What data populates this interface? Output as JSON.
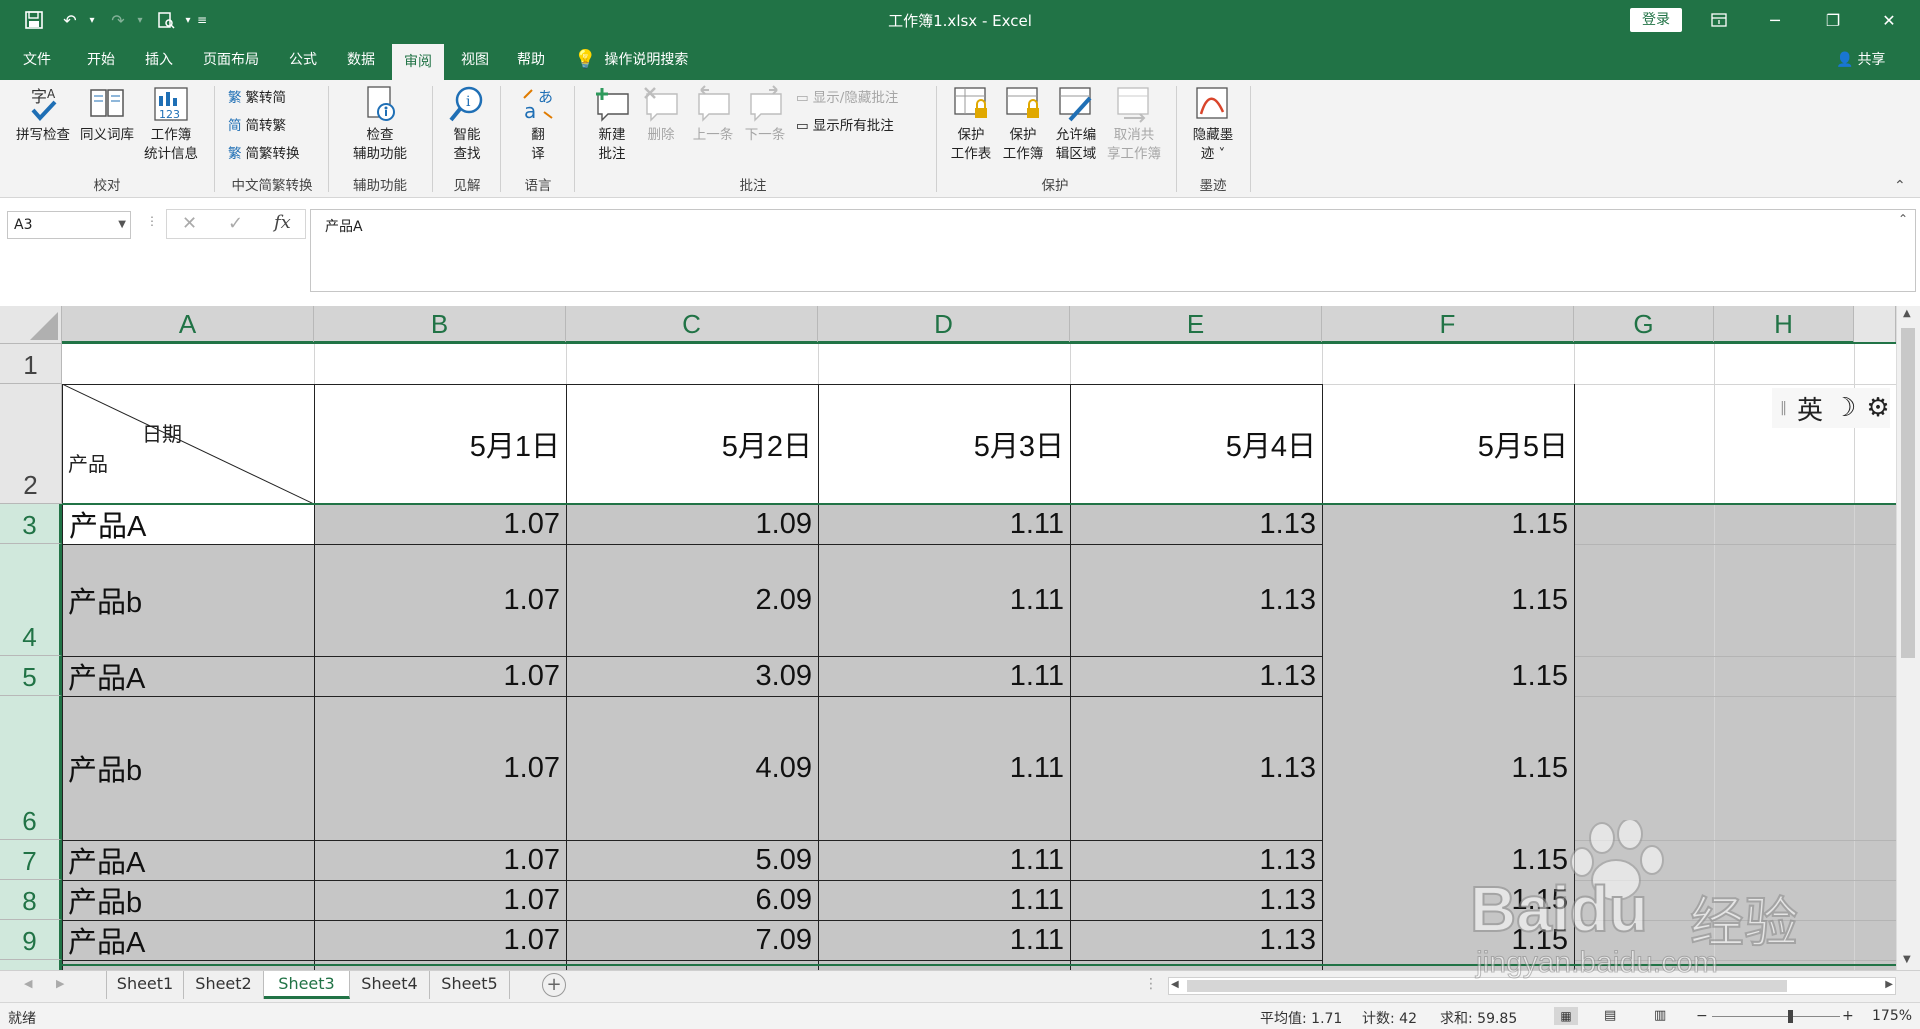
{
  "titlebar": {
    "title": "工作簿1.xlsx  -  Excel",
    "login": "登录"
  },
  "tabs": [
    "文件",
    "开始",
    "插入",
    "页面布局",
    "公式",
    "数据",
    "审阅",
    "视图",
    "帮助"
  ],
  "active_tab": "审阅",
  "tell_me": "操作说明搜索",
  "share": "共享",
  "ribbon": {
    "spelling": "拼写检查",
    "thesaurus": "同义词库",
    "workbook_stats_1": "工作簿",
    "workbook_stats_2": "统计信息",
    "group_proofing": "校对",
    "to_traditional": "繁转简",
    "to_simplified": "简转繁",
    "convert": "简繁转换",
    "group_chinese": "中文简繁转换",
    "check_access_1": "检查",
    "check_access_2": "辅助功能",
    "group_access": "辅助功能",
    "smart_lookup_1": "智能",
    "smart_lookup_2": "查找",
    "group_insights": "见解",
    "translate_1": "翻",
    "translate_2": "译",
    "group_language": "语言",
    "new_comment_1": "新建",
    "new_comment_2": "批注",
    "delete": "删除",
    "prev": "上一条",
    "next": "下一条",
    "show_hide_comment": "显示/隐藏批注",
    "show_all_comments": "显示所有批注",
    "group_comments": "批注",
    "protect_sheet_1": "保护",
    "protect_sheet_2": "工作表",
    "protect_wb_1": "保护",
    "protect_wb_2": "工作簿",
    "allow_edit_1": "允许编",
    "allow_edit_2": "辑区域",
    "unshare_1": "取消共",
    "unshare_2": "享工作簿",
    "group_protect": "保护",
    "hide_ink_1": "隐藏墨",
    "hide_ink_2": "迹",
    "group_ink": "墨迹"
  },
  "formula_bar": {
    "name_box": "A3",
    "cancel": "✕",
    "enter": "✓",
    "fx": "fx",
    "content": "产品A"
  },
  "columns": [
    "A",
    "B",
    "C",
    "D",
    "E",
    "F",
    "G",
    "H"
  ],
  "rows": [
    "1",
    "2",
    "3",
    "4",
    "5",
    "6",
    "7",
    "8",
    "9"
  ],
  "header_row": {
    "diag_top": "日期",
    "diag_bottom": "产品",
    "dates": [
      "5月1日",
      "5月2日",
      "5月3日",
      "5月4日",
      "5月5日"
    ]
  },
  "data_rows": [
    {
      "product": "产品A",
      "values": [
        "1.07",
        "1.09",
        "1.11",
        "1.13",
        "1.15"
      ]
    },
    {
      "product": "产品b",
      "values": [
        "1.07",
        "2.09",
        "1.11",
        "1.13",
        "1.15"
      ]
    },
    {
      "product": "产品A",
      "values": [
        "1.07",
        "3.09",
        "1.11",
        "1.13",
        "1.15"
      ]
    },
    {
      "product": "产品b",
      "values": [
        "1.07",
        "4.09",
        "1.11",
        "1.13",
        "1.15"
      ]
    },
    {
      "product": "产品A",
      "values": [
        "1.07",
        "5.09",
        "1.11",
        "1.13",
        "1.15"
      ]
    },
    {
      "product": "产品b",
      "values": [
        "1.07",
        "6.09",
        "1.11",
        "1.13",
        "1.15"
      ]
    },
    {
      "product": "产品A",
      "values": [
        "1.07",
        "7.09",
        "1.11",
        "1.13",
        "1.15"
      ]
    }
  ],
  "ime": {
    "mode": "英"
  },
  "sheets": [
    "Sheet1",
    "Sheet2",
    "Sheet3",
    "Sheet4",
    "Sheet5"
  ],
  "active_sheet": "Sheet3",
  "status": {
    "ready": "就绪",
    "average": "平均值: 1.71",
    "count": "计数: 42",
    "sum": "求和: 59.85",
    "zoom": "175%"
  },
  "watermark": {
    "brand": "Baidu",
    "sub": "经验",
    "url": "jingyan.baidu.com"
  }
}
